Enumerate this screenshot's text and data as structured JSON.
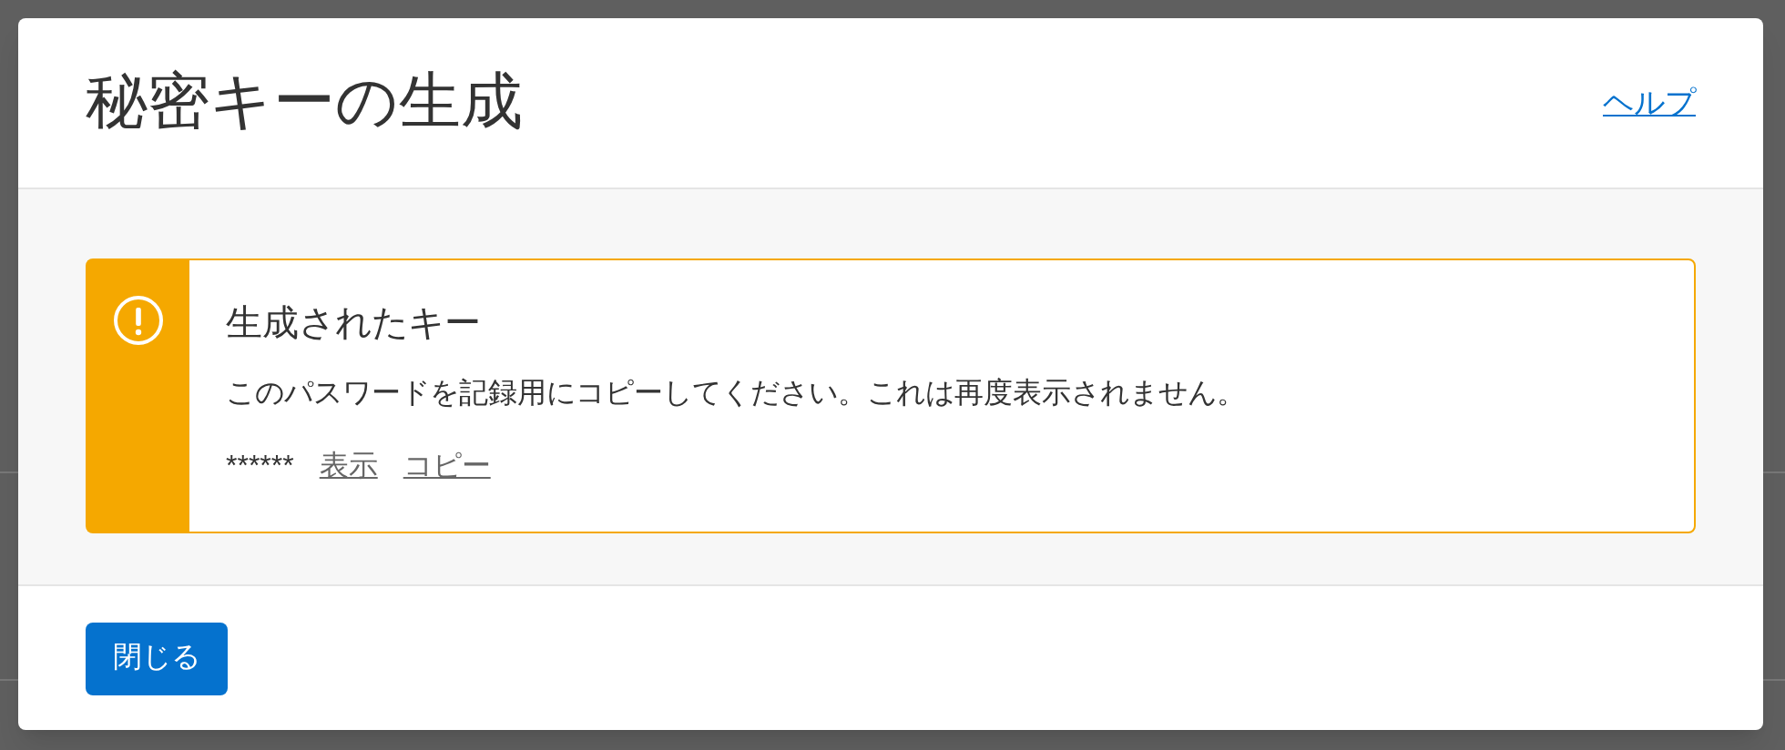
{
  "dialog": {
    "title": "秘密キーの生成",
    "help_link": "ヘルプ"
  },
  "alert": {
    "kind": "warning",
    "title": "生成されたキー",
    "message": "このパスワードを記録用にコピーしてください。これは再度表示されません。",
    "masked_value": "******",
    "actions": [
      "表示",
      "コピー"
    ]
  },
  "footer": {
    "buttons": [
      "閉じる"
    ]
  }
}
